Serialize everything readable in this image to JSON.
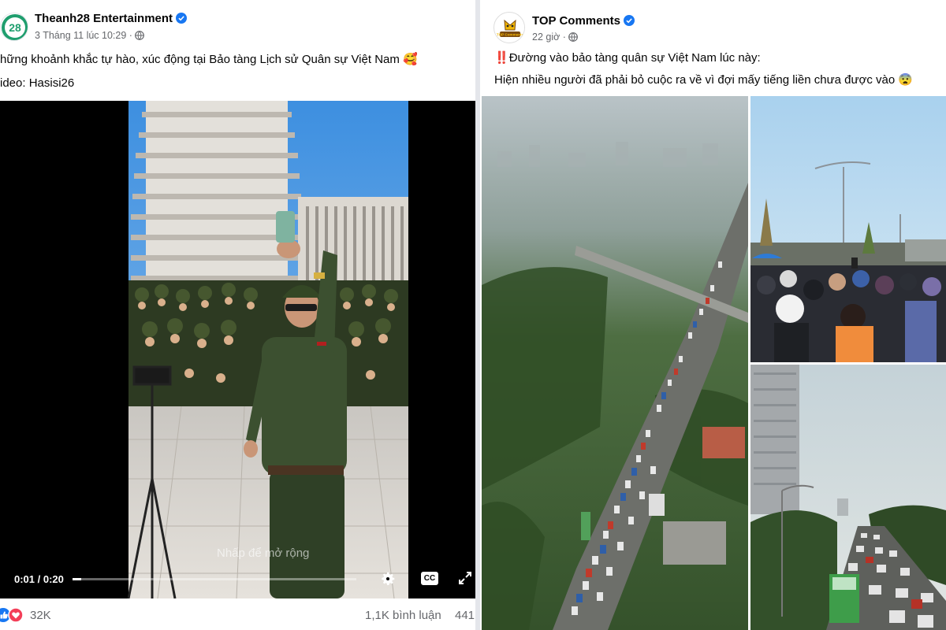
{
  "left_post": {
    "page_name": "Theanh28 Entertainment",
    "avatar_text": "28",
    "timestamp": "3 Tháng 11 lúc 10:29 ·",
    "text_line1": "hững khoảnh khắc tự hào, xúc động tại Bảo tàng Lịch sử Quân sự Việt Nam",
    "text_line1_emoji": "🥰",
    "text_line2": "ideo: Hasisi26",
    "video": {
      "overlay_text": "Nhấp để mở rộng",
      "time_label": "0:01 / 0:20",
      "progress": 0.03,
      "cc_label": "CC",
      "settings_icon": "gear-icon",
      "expand_icon": "expand-icon"
    },
    "reactions": {
      "count": "32K",
      "comments": "1,1K bình luận",
      "shares": "441"
    },
    "colors": {
      "avatar_bg": "#1f9e6e",
      "verified": "#1877f2"
    }
  },
  "right_post": {
    "page_name": "TOP Comments",
    "avatar_text": "TOP Comments",
    "timestamp": "22 giờ ·",
    "text_line1_prefix": "‼️",
    "text_line1": "Đường vào bảo tàng quân sự Việt Nam lúc này:",
    "text_line2": "Hiện nhiều người đã phải bỏ cuộc ra về vì đợi mấy tiếng liền chưa được vào",
    "text_line2_emoji": "😨",
    "colors": {
      "verified": "#1877f2",
      "avatar_ring": "#f2b705"
    }
  }
}
